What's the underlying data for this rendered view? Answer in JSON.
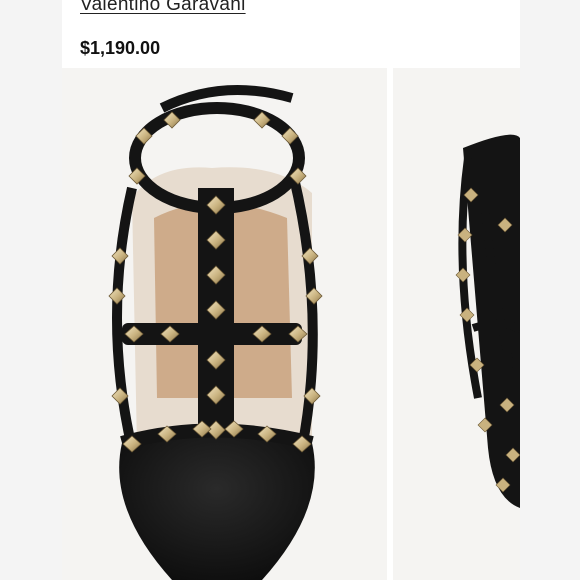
{
  "product": {
    "brand": "Valentino Garavani",
    "price": "$1,190.00"
  },
  "gallery": {
    "images": [
      {
        "label": "product-image-front",
        "subject": "black studded pump, front view"
      },
      {
        "label": "product-image-side",
        "subject": "black studded pump, side view"
      }
    ]
  },
  "colors": {
    "leather": "#141414",
    "stud": "#c9b27f",
    "lining": "#c9a27e",
    "background": "#f5f4f2"
  }
}
